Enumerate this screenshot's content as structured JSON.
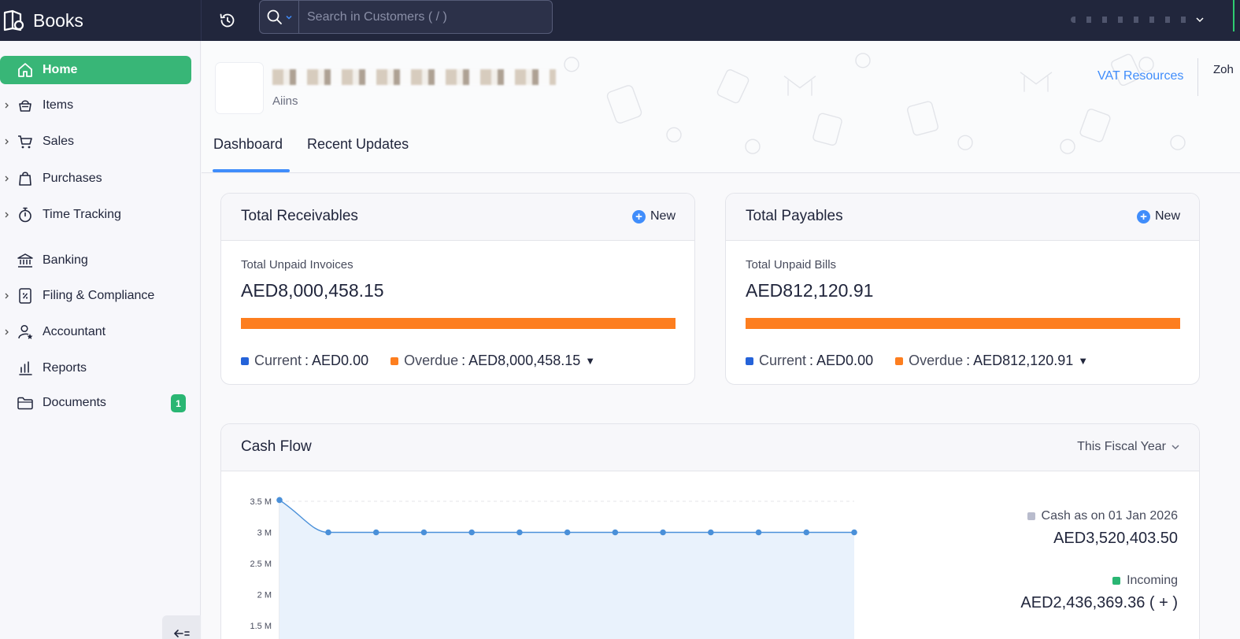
{
  "app": {
    "name": "Books"
  },
  "search": {
    "placeholder": "Search in Customers ( / )"
  },
  "sidebar": {
    "items": [
      {
        "label": "Home"
      },
      {
        "label": "Items"
      },
      {
        "label": "Sales"
      },
      {
        "label": "Purchases"
      },
      {
        "label": "Time Tracking"
      },
      {
        "label": "Banking"
      },
      {
        "label": "Filing & Compliance"
      },
      {
        "label": "Accountant"
      },
      {
        "label": "Reports"
      },
      {
        "label": "Documents",
        "badge": "1"
      }
    ]
  },
  "banner": {
    "org_subtitle": "Aiins",
    "vat_link": "VAT Resources",
    "partial_text": "Zoh"
  },
  "tabs": [
    {
      "label": "Dashboard"
    },
    {
      "label": "Recent Updates"
    }
  ],
  "receivables": {
    "title": "Total Receivables",
    "new_label": "New",
    "unpaid_label": "Total Unpaid Invoices",
    "unpaid_amount": "AED8,000,458.15",
    "current_label": "Current",
    "current_value": ": AED0.00",
    "overdue_label": "Overdue",
    "overdue_value": ": AED8,000,458.15",
    "overdue_fraction": 1.0
  },
  "payables": {
    "title": "Total Payables",
    "new_label": "New",
    "unpaid_label": "Total Unpaid Bills",
    "unpaid_amount": "AED812,120.91",
    "current_label": "Current",
    "current_value": ": AED0.00",
    "overdue_label": "Overdue",
    "overdue_value": ": AED812,120.91",
    "overdue_fraction": 1.0
  },
  "cashflow": {
    "title": "Cash Flow",
    "period": "This Fiscal Year",
    "cash_label": "Cash as on 01 Jan 2026",
    "cash_value": "AED3,520,403.50",
    "incoming_label": "Incoming",
    "incoming_value": "AED2,436,369.36 ( + )"
  },
  "colors": {
    "topbar": "#21263c",
    "active_nav": "#38b677",
    "accent": "#408dfb",
    "overdue": "#fd7e1f",
    "current": "#2563d9",
    "cash_legend": "#b9bccd",
    "incoming_legend": "#2ab673"
  },
  "chart_data": {
    "type": "line",
    "yticks": [
      "3.5 M",
      "3 M",
      "2.5 M",
      "2 M",
      "1.5 M"
    ],
    "values": [
      3.52,
      3.0,
      3.0,
      3.0,
      3.0,
      3.0,
      3.0,
      3.0,
      3.0,
      3.0,
      3.0,
      3.0,
      3.0
    ],
    "unit": "M",
    "grid": true
  }
}
